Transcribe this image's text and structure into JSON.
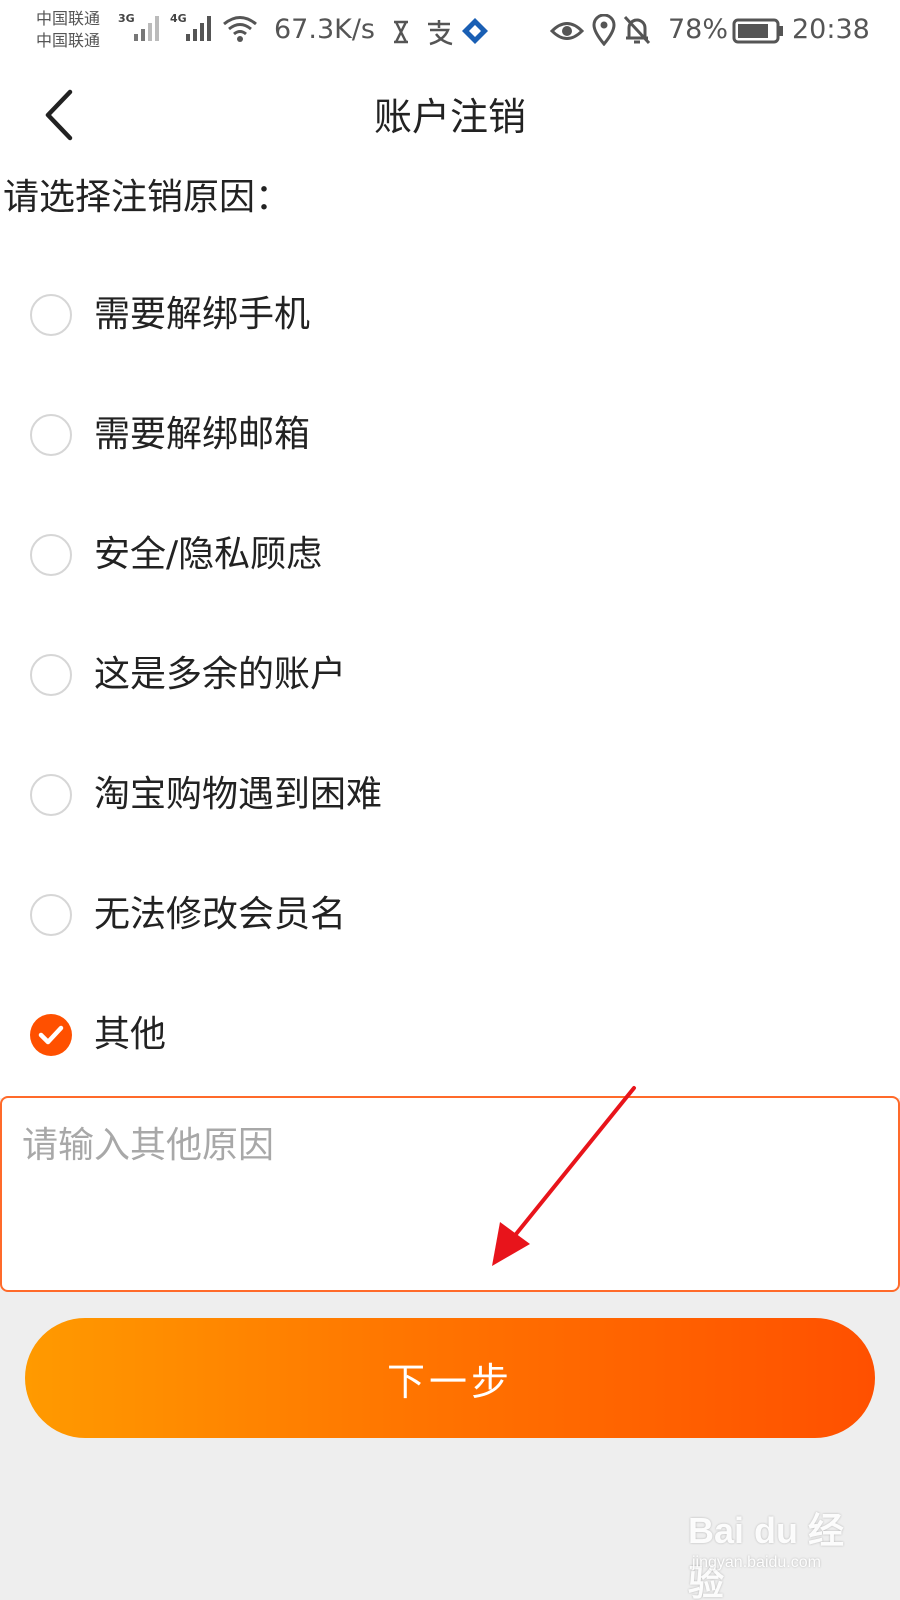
{
  "status_bar": {
    "carrier_1": "中国联通",
    "carrier_2": "中国联通",
    "net_1": "3G",
    "net_2": "4G",
    "speed": "67.3K/s",
    "battery": "78%",
    "time": "20:38",
    "icons": [
      "signal-icon",
      "signal-icon",
      "wifi-icon",
      "hourglass-icon",
      "alipay-icon",
      "app-badge-icon",
      "eye-icon",
      "location-icon",
      "mute-bell-icon",
      "battery-icon"
    ]
  },
  "header": {
    "title": "账户注销",
    "back_icon": "chevron-left-icon"
  },
  "prompt": "请选择注销原因：",
  "options": [
    {
      "label": "需要解绑手机",
      "checked": false
    },
    {
      "label": "需要解绑邮箱",
      "checked": false
    },
    {
      "label": "安全/隐私顾虑",
      "checked": false
    },
    {
      "label": "这是多余的账户",
      "checked": false
    },
    {
      "label": "淘宝购物遇到困难",
      "checked": false
    },
    {
      "label": "无法修改会员名",
      "checked": false
    },
    {
      "label": "其他",
      "checked": true
    }
  ],
  "reason_input": {
    "placeholder": "请输入其他原因",
    "value": ""
  },
  "next_button": "下一步",
  "colors": {
    "accent": "#ff5000",
    "gradient_start": "#ff9a00",
    "gradient_end": "#ff5000",
    "annotation_arrow": "#e8141b"
  },
  "watermark": {
    "main": "Bai du 经验",
    "sub": "jingyan.baidu.com"
  }
}
